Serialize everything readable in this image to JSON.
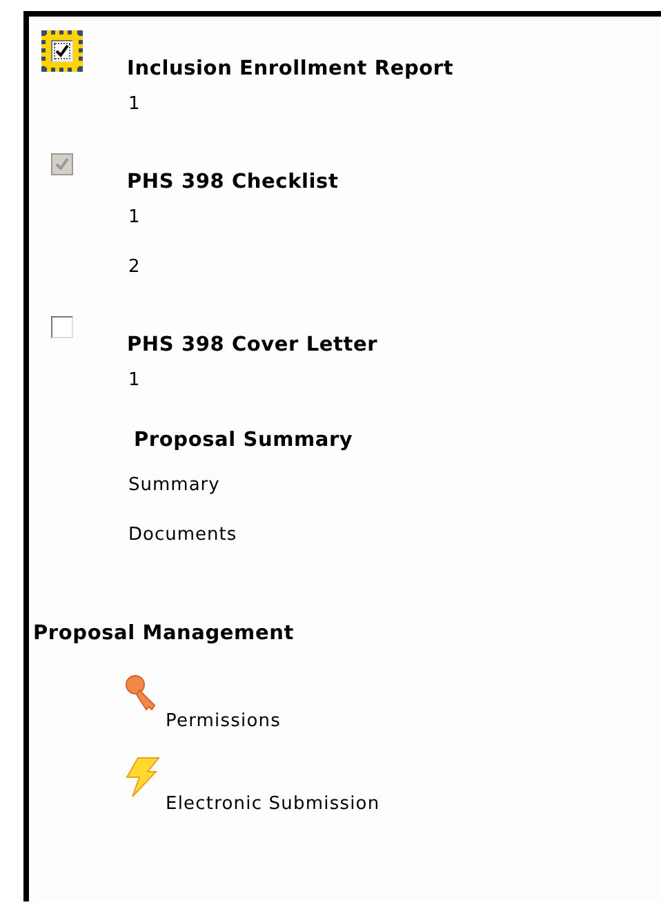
{
  "forms": [
    {
      "title": "Inclusion Enrollment Report",
      "checked": true,
      "disabled": false,
      "focused": true,
      "items": [
        "1"
      ]
    },
    {
      "title": "PHS 398 Checklist",
      "checked": true,
      "disabled": true,
      "focused": false,
      "items": [
        "1",
        "2"
      ]
    },
    {
      "title": "PHS 398 Cover Letter",
      "checked": false,
      "disabled": false,
      "focused": false,
      "items": [
        "1"
      ]
    }
  ],
  "proposal_summary": {
    "title": "Proposal Summary",
    "items": [
      "Summary",
      "Documents"
    ]
  },
  "proposal_management": {
    "title": "Proposal Management",
    "items": [
      {
        "label": "Permissions",
        "kind": "key"
      },
      {
        "label": "Electronic Submission",
        "kind": "bolt"
      }
    ]
  }
}
